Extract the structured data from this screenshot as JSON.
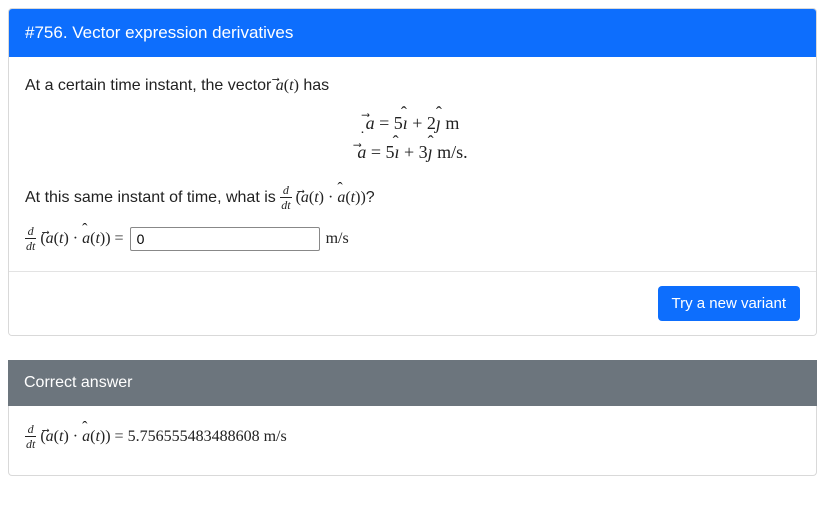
{
  "header": {
    "title": "#756. Vector expression derivatives"
  },
  "intro": {
    "prefix": "At a certain time instant, the vector ",
    "vector_symbol": "a",
    "time_symbol": "t",
    "suffix": " has"
  },
  "equations": {
    "a_eq": "a⃗ = 5ı̂ + 2ȷ̂ m",
    "adot_eq": "a⃗̇ = 5ı̂ + 3ȷ̂ m/s.",
    "a_components": {
      "i": 5,
      "j": 2,
      "unit": "m"
    },
    "adot_components": {
      "i": 5,
      "j": 3,
      "unit": "m/s"
    }
  },
  "question": {
    "prefix": "At this same instant of time, what is ",
    "deriv_label": "d/dt (a⃗(t) · â(t))",
    "suffix": "?"
  },
  "answer_row": {
    "lhs": "d/dt (a⃗(t) · â(t)) =",
    "input_value": "0",
    "unit": "m/s"
  },
  "button": {
    "label": "Try a new variant"
  },
  "correct": {
    "header": "Correct answer",
    "value": "5.756555483488608",
    "unit": "m/s",
    "full": "d/dt (a⃗(t) · â(t)) = 5.756555483488608 m/s"
  }
}
